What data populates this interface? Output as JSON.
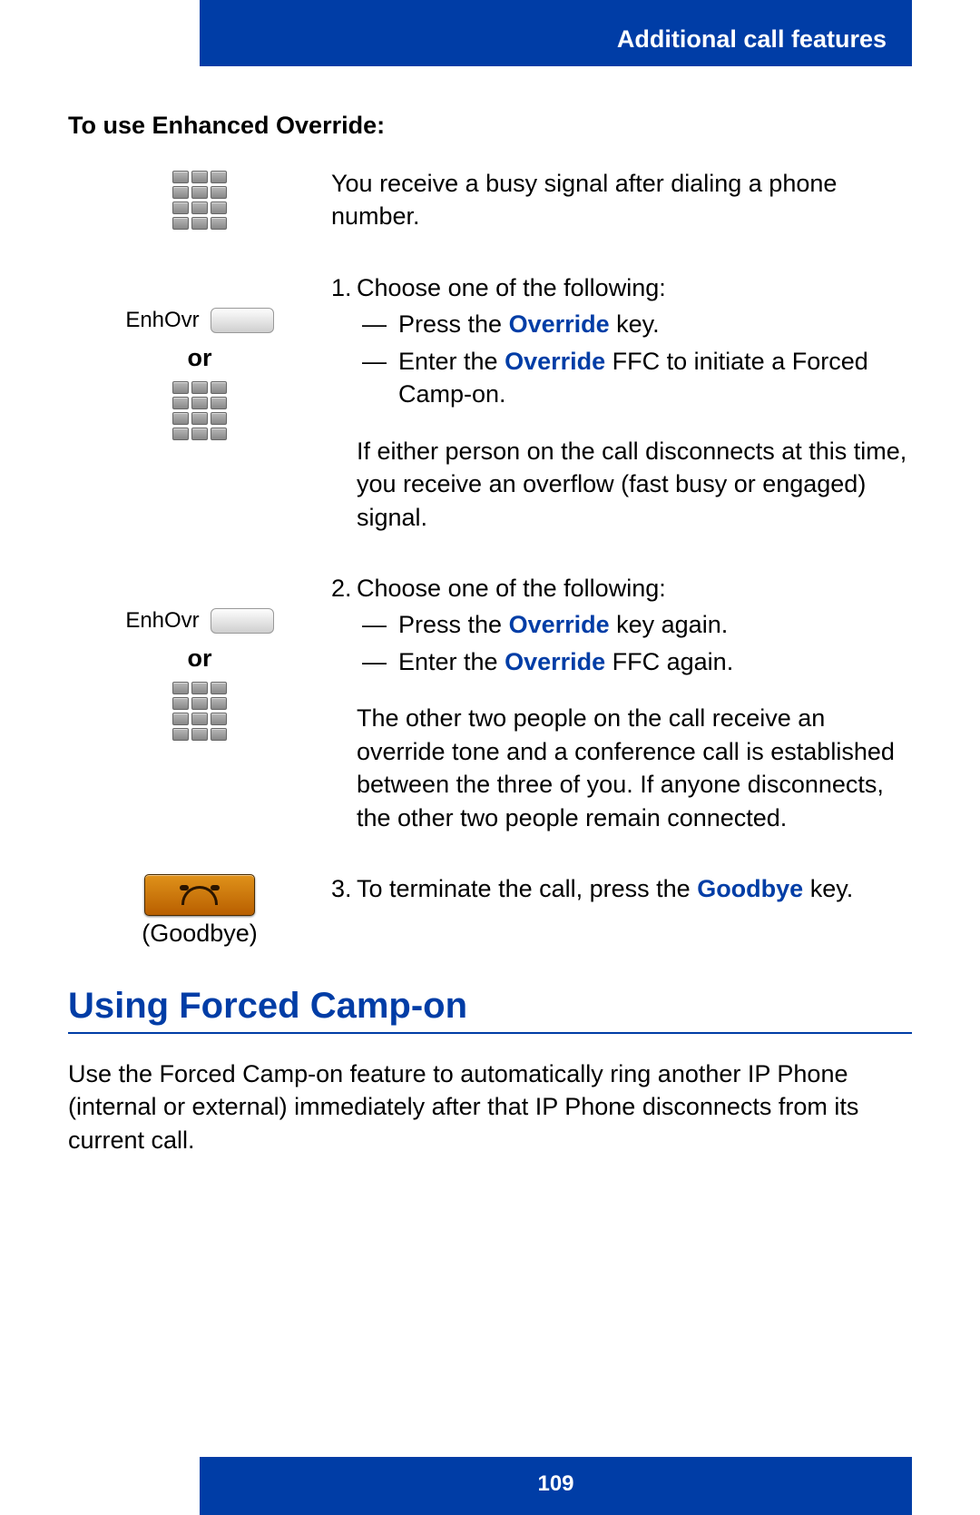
{
  "header": {
    "section_title": "Additional call features"
  },
  "section_heading": "To use Enhanced Override:",
  "steps": {
    "intro_text": "You receive a busy signal after dialing a phone number.",
    "softkey_label": "EnhOvr",
    "or_label": "or",
    "step1_lead": "Choose one of the following:",
    "step1_bullets": {
      "a_prefix": "Press the ",
      "a_bold": "Override",
      "a_suffix": " key.",
      "b_prefix": "Enter the ",
      "b_bold": "Override",
      "b_suffix": " FFC to initiate a Forced Camp-on."
    },
    "step1_note": "If either person on the call disconnects at this time, you receive an overflow (fast busy or engaged) signal.",
    "step2_lead": "Choose one of the following:",
    "step2_bullets": {
      "a_prefix": "Press the ",
      "a_bold": "Override",
      "a_suffix": " key again.",
      "b_prefix": "Enter the ",
      "b_bold": "Override",
      "b_suffix": " FFC again."
    },
    "step2_note": "The other two people on the call receive an override tone and a conference call is established between the three of you. If anyone disconnects, the other two people remain connected.",
    "step3_prefix": "To terminate the call, press the ",
    "step3_bold": "Goodbye",
    "step3_suffix": " key.",
    "goodbye_caption": "(Goodbye)"
  },
  "next_section": {
    "title": "Using Forced Camp-on",
    "body": "Use the Forced Camp-on feature to automatically ring another IP Phone (internal or external) immediately after that IP Phone disconnects from its current call."
  },
  "page_number": "109"
}
